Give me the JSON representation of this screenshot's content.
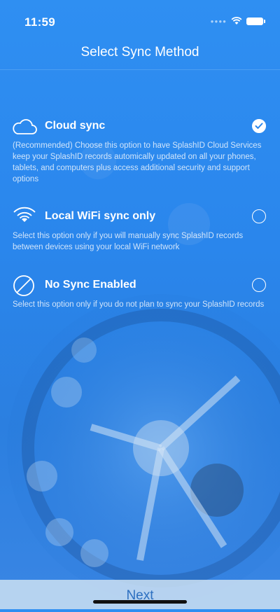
{
  "status": {
    "time": "11:59"
  },
  "nav": {
    "title": "Select Sync Method"
  },
  "options": [
    {
      "title": "Cloud sync",
      "description": "(Recommended) Choose this option to have SplashID Cloud Services keep your SplashID records automically updated on all your phones, tablets, and computers plus access additional security and support options",
      "icon": "cloud-icon",
      "selected": true
    },
    {
      "title": "Local WiFi sync only",
      "description": "Select this option only if you will manually sync SplashID records between devices using your local WiFi network",
      "icon": "wifi-icon",
      "selected": false
    },
    {
      "title": "No Sync Enabled",
      "description": "Select this option only if you do not plan to sync your SplashID records",
      "icon": "no-sync-icon",
      "selected": false
    }
  ],
  "footer": {
    "next_label": "Next"
  },
  "colors": {
    "background": "#2b86ec",
    "next_text": "#2c6fc0"
  }
}
